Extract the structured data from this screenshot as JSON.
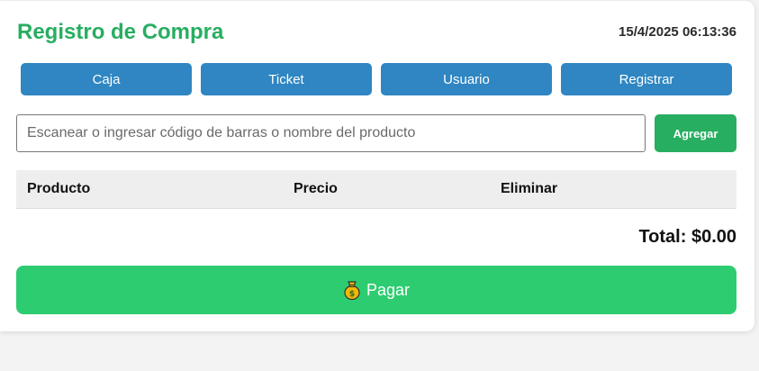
{
  "header": {
    "title": "Registro de Compra",
    "datetime": "15/4/2025 06:13:36"
  },
  "nav": {
    "items": [
      {
        "label": "Caja"
      },
      {
        "label": "Ticket"
      },
      {
        "label": "Usuario"
      },
      {
        "label": "Registrar"
      }
    ]
  },
  "search": {
    "placeholder": "Escanear o ingresar código de barras o nombre del producto",
    "value": "",
    "add_label": "Agregar"
  },
  "table": {
    "columns": [
      "Producto",
      "Precio",
      "Eliminar"
    ],
    "rows": []
  },
  "total": {
    "text": "Total: $0.00"
  },
  "pay": {
    "label": "Pagar",
    "icon": "money-bag-icon"
  },
  "colors": {
    "title_green": "#27ae60",
    "nav_blue": "#2f86c2",
    "add_green": "#27ae60",
    "pay_green": "#2ecc71"
  }
}
